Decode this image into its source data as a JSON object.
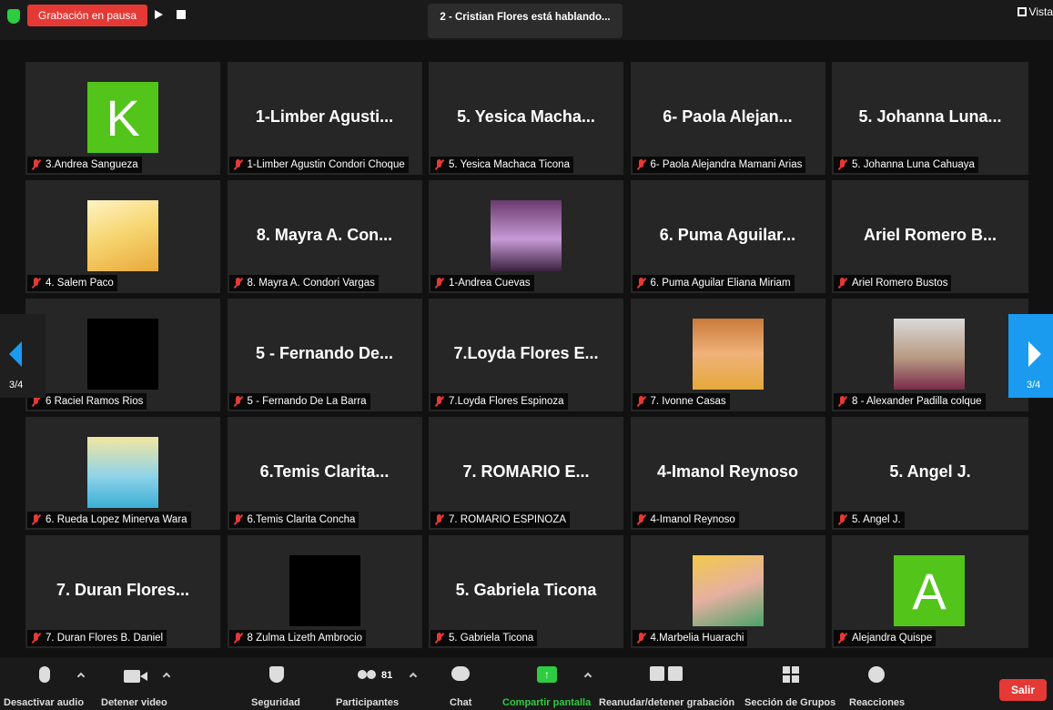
{
  "top_bar": {
    "recording_status": "Grabación en pausa",
    "speaker": "2 - Cristian Flores está hablando...",
    "view_label": "Vista"
  },
  "pagination": {
    "left": "3/4",
    "right": "3/4"
  },
  "tiles": [
    {
      "name": "",
      "label": "3.Andrea Sangueza",
      "avatar": "K"
    },
    {
      "name": "1-Limber Agusti...",
      "label": "1-Limber Agustin Condori Choque"
    },
    {
      "name": "5. Yesica Macha...",
      "label": "5. Yesica Machaca Ticona"
    },
    {
      "name": "6- Paola Alejan...",
      "label": "6- Paola Alejandra Mamani Arias"
    },
    {
      "name": "5. Johanna Luna...",
      "label": "5. Johanna Luna Cahuaya"
    },
    {
      "name": "",
      "label": "4. Salem Paco"
    },
    {
      "name": "8. Mayra A. Con...",
      "label": "8. Mayra A. Condori Vargas"
    },
    {
      "name": "",
      "label": "1-Andrea Cuevas"
    },
    {
      "name": "6. Puma Aguilar...",
      "label": "6. Puma Aguilar Eliana Miriam"
    },
    {
      "name": "Ariel Romero B...",
      "label": "Ariel Romero Bustos"
    },
    {
      "name": "",
      "label": "6 Raciel Ramos Rios"
    },
    {
      "name": "5 - Fernando De...",
      "label": "5 - Fernando De La Barra"
    },
    {
      "name": "7.Loyda Flores E...",
      "label": "7.Loyda Flores Espinoza"
    },
    {
      "name": "",
      "label": "7. Ivonne Casas"
    },
    {
      "name": "",
      "label": "8 - Alexander Padilla colque"
    },
    {
      "name": "",
      "label": "6. Rueda Lopez Minerva Wara"
    },
    {
      "name": "6.Temis Clarita...",
      "label": "6.Temis Clarita Concha"
    },
    {
      "name": "7.   ROMARIO E...",
      "label": "7.   ROMARIO ESPINOZA"
    },
    {
      "name": "4-Imanol Reynoso",
      "label": "4-Imanol Reynoso"
    },
    {
      "name": "5. Angel J.",
      "label": "5. Angel J."
    },
    {
      "name": "7. Duran Flores...",
      "label": "7. Duran Flores B. Daniel"
    },
    {
      "name": "",
      "label": "8 Zulma Lizeth Ambrocio"
    },
    {
      "name": "5. Gabriela Ticona",
      "label": "5. Gabriela Ticona"
    },
    {
      "name": "",
      "label": "4.Marbelia Huarachi"
    },
    {
      "name": "",
      "label": "Alejandra Quispe",
      "avatar": "A"
    }
  ],
  "toolbar": {
    "mute": "Desactivar audio",
    "stop_video": "Detener video",
    "security": "Seguridad",
    "participants": "Participantes",
    "participants_count": "81",
    "chat": "Chat",
    "share": "Compartir pantalla",
    "record": "Reanudar/detener grabación",
    "breakout": "Sección de Grupos",
    "reactions": "Reacciones",
    "leave": "Salir"
  }
}
